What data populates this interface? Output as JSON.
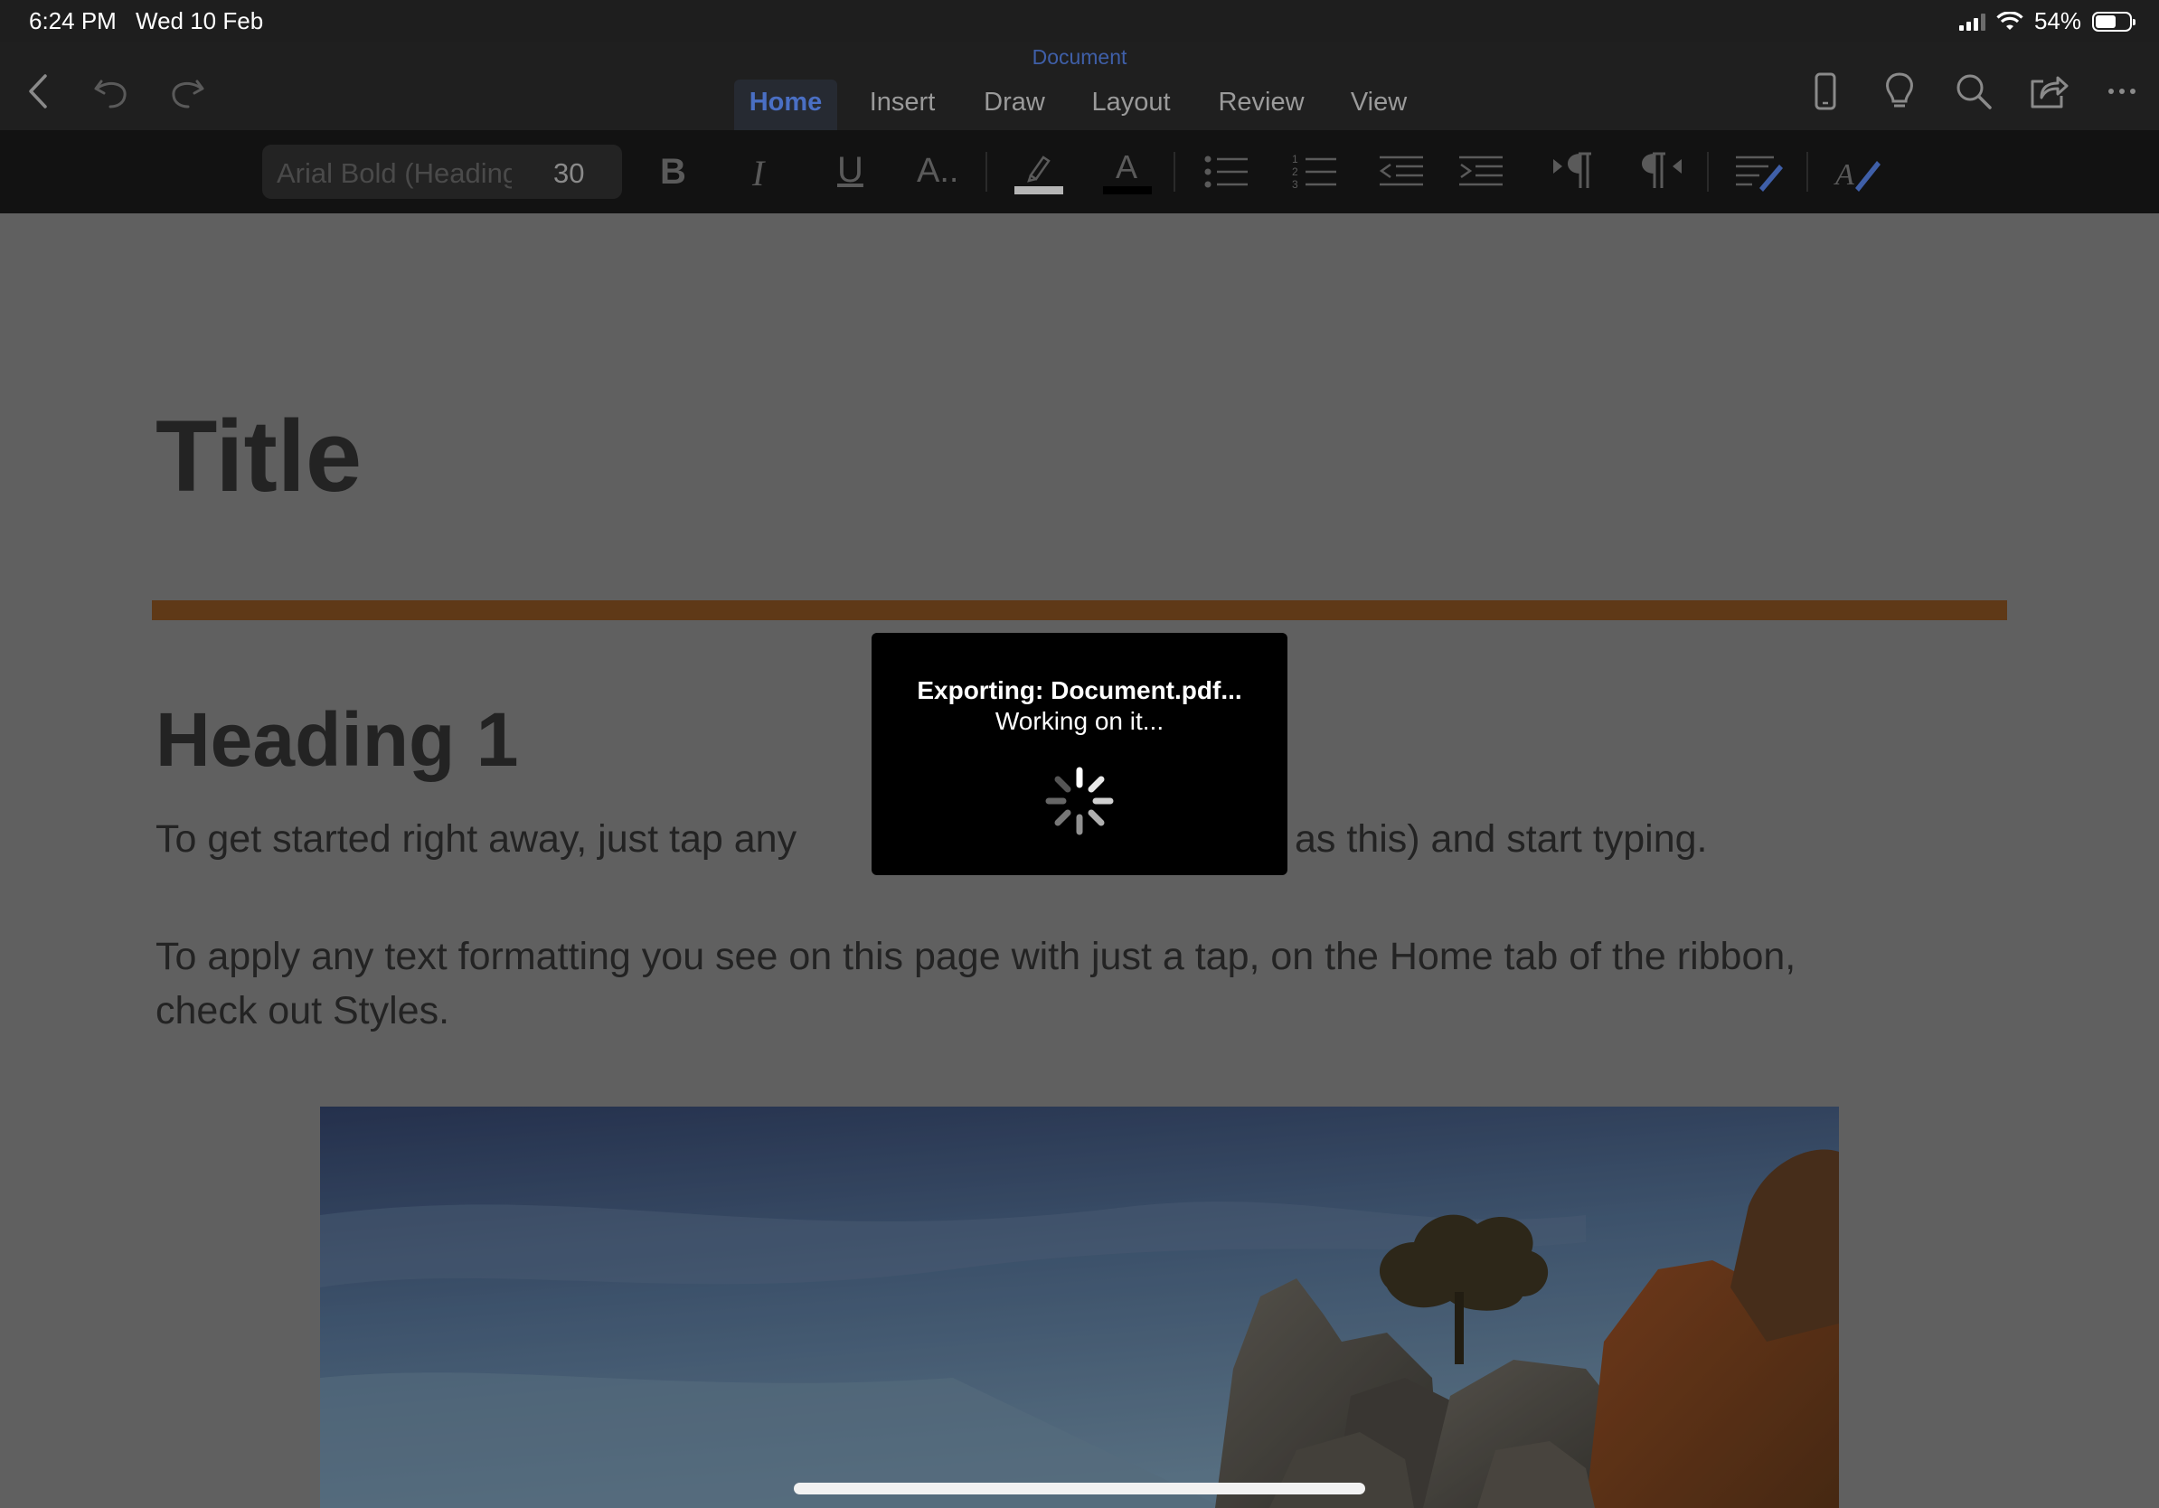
{
  "status": {
    "time": "6:24 PM",
    "date": "Wed 10 Feb",
    "battery": "54%",
    "battery_level": 0.54
  },
  "app": {
    "document_title": "Document",
    "nav": [
      "back-icon",
      "undo-icon",
      "redo-icon"
    ],
    "tabs": [
      {
        "label": "Home",
        "active": true
      },
      {
        "label": "Insert",
        "active": false
      },
      {
        "label": "Draw",
        "active": false
      },
      {
        "label": "Layout",
        "active": false
      },
      {
        "label": "Review",
        "active": false
      },
      {
        "label": "View",
        "active": false
      }
    ],
    "right_icons": [
      "phone-layout-icon",
      "lightbulb-icon",
      "search-icon",
      "share-icon",
      "more-icon"
    ]
  },
  "ribbon": {
    "font_name": "Arial Bold (Headings)",
    "font_size": "30",
    "bold_glyph": "B",
    "italic_glyph": "I",
    "underline_glyph": "U",
    "more_format_glyph": "A..",
    "font_color_glyph": "A",
    "highlight_color": "#b5b5b5",
    "font_color": "#000000",
    "icons": [
      "bold-icon",
      "italic-icon",
      "underline-icon",
      "more-formatting-icon",
      "highlight-icon",
      "font-color-icon",
      "bullets-icon",
      "numbering-icon",
      "decrease-indent-icon",
      "increase-indent-icon",
      "ltr-paragraph-icon",
      "rtl-paragraph-icon",
      "styles-icon",
      "clear-formatting-icon"
    ]
  },
  "document": {
    "title": "Title",
    "rule_color": "#7a4a1e",
    "heading1": "Heading 1",
    "para1_left": "To get started right away, just tap any",
    "para1_right": "as this) and start typing.",
    "para2_line1": "To apply any text formatting you see on this page with just a tap, on the Home tab of the ribbon,",
    "para2_line2": "check out Styles."
  },
  "dialog": {
    "line1": "Exporting: Document.pdf...",
    "line2": "Working on it..."
  }
}
